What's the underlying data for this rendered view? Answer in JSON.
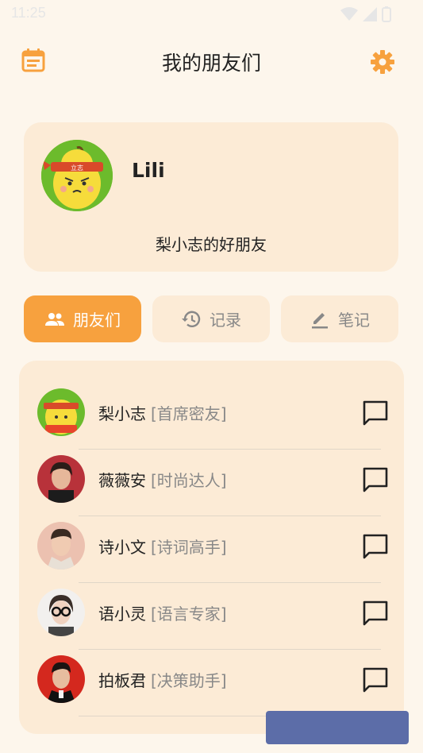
{
  "status": {
    "time": "11:25"
  },
  "header": {
    "title": "我的朋友们"
  },
  "profile": {
    "name": "Lili",
    "subtitle": "梨小志的好朋友",
    "badge": "立志"
  },
  "tabs": [
    {
      "label": "朋友们",
      "icon": "people-icon",
      "active": true
    },
    {
      "label": "记录",
      "icon": "history-icon",
      "active": false
    },
    {
      "label": "笔记",
      "icon": "edit-icon",
      "active": false
    }
  ],
  "friends": [
    {
      "name": "梨小志",
      "tag": "[首席密友]"
    },
    {
      "name": "薇薇安",
      "tag": "[时尚达人]"
    },
    {
      "name": "诗小文",
      "tag": "[诗词高手]"
    },
    {
      "name": "语小灵",
      "tag": "[语言专家]"
    },
    {
      "name": "拍板君",
      "tag": "[决策助手]"
    }
  ],
  "colors": {
    "accent": "#f7a13e",
    "card": "#fcebd6",
    "background": "#fdf6ec"
  }
}
